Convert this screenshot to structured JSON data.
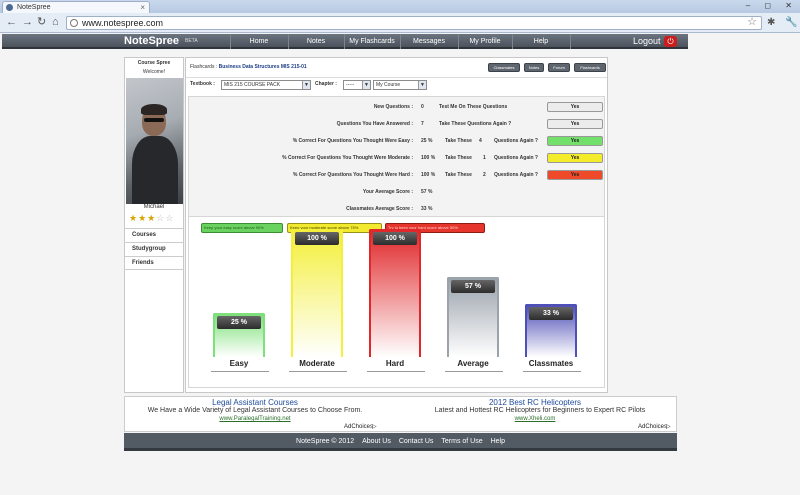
{
  "browser": {
    "tab_title": "NoteSpree",
    "tab_close": "×",
    "window_controls": "–  ◻  ✕",
    "url": "www.notespree.com"
  },
  "nav": {
    "brand": "NoteSpree",
    "beta": "BETA",
    "items": [
      "Home",
      "Notes",
      "My Flashcards",
      "Messages",
      "My Profile",
      "Help"
    ],
    "logout": "Logout"
  },
  "sidebar": {
    "title": "Course Spree",
    "welcome": "Welcome!",
    "username": "Michael",
    "rating": 3,
    "rating_max": 5,
    "links": [
      "Courses",
      "Studygroup",
      "Friends"
    ]
  },
  "flashcards": {
    "crumb_prefix": "Flashcards :",
    "course": "Business Data Structures MIS 215-01",
    "buttons": [
      "Classmates",
      "Notes",
      "Forum",
      "Flashcards"
    ],
    "textbook_label": "Textbook :",
    "textbook_value": "MIS 215 COURSE PACK",
    "chapter_label": "Chapter :",
    "chapter_value": "-----",
    "course_value": "My Course"
  },
  "stats": {
    "rows": [
      {
        "label": "New Questions :",
        "value": "0",
        "question": "Test Me On These Questions",
        "button": "Yes",
        "color": "#ececec"
      },
      {
        "label": "Questions You Have Answered :",
        "value": "7",
        "question": "Take These Questions Again ?",
        "button": "Yes",
        "color": "#ececec"
      },
      {
        "label": "% Correct For Questions You Thought Were Easy :",
        "value": "25 %",
        "take": "Take These",
        "count": "4",
        "suffix": "Questions Again ?",
        "button": "Yes",
        "color": "#72e06a"
      },
      {
        "label": "% Correct For Questions You Thought Were Moderate :",
        "value": "100 %",
        "take": "Take These",
        "count": "1",
        "suffix": "Questions Again ?",
        "button": "Yes",
        "color": "#f4ec2a"
      },
      {
        "label": "% Correct For Questions You Thought Were Hard :",
        "value": "100 %",
        "take": "Take These",
        "count": "2",
        "suffix": "Questions Again ?",
        "button": "Yes",
        "color": "#ee4a2a"
      },
      {
        "label": "Your Average Score :",
        "value": "57 %"
      },
      {
        "label": "Classmates Average Score :",
        "value": "33 %"
      }
    ]
  },
  "chart_data": {
    "type": "bar",
    "categories": [
      "Easy",
      "Moderate",
      "Hard",
      "Average",
      "Classmates"
    ],
    "values": [
      25,
      100,
      100,
      57,
      33
    ],
    "value_labels": [
      "25 %",
      "100 %",
      "100 %",
      "57 %",
      "33 %"
    ],
    "ylim": [
      0,
      100
    ],
    "colors": [
      "#7ee07a",
      "#f3ef3a",
      "#e0282b",
      "#9aa2ab",
      "#4f4fb8"
    ],
    "legend": [
      {
        "text": "Keep your easy score above 90%",
        "color": "#6ad25f"
      },
      {
        "text": "Keep your moderate score above 75%",
        "color": "#f2ea2e"
      },
      {
        "text": "Try to keep your hard score above 50%",
        "color": "#e6352a"
      }
    ],
    "title": "",
    "xlabel": "",
    "ylabel": ""
  },
  "ads": [
    {
      "title": "Legal Assistant Courses",
      "text": "We Have a Wide Variety of Legal Assistant Courses to Choose From.",
      "url": "www.ParalegalTraining.net"
    },
    {
      "title": "2012 Best RC Helicopters",
      "text": "Latest and Hottest RC Helicopters for Beginners to Expert RC Pilots",
      "url": "www.Xheli.com"
    }
  ],
  "adchoices": "AdChoices",
  "footer": {
    "copyright": "NoteSpree © 2012",
    "links": [
      "About Us",
      "Contact Us",
      "Terms of Use",
      "Help"
    ]
  }
}
